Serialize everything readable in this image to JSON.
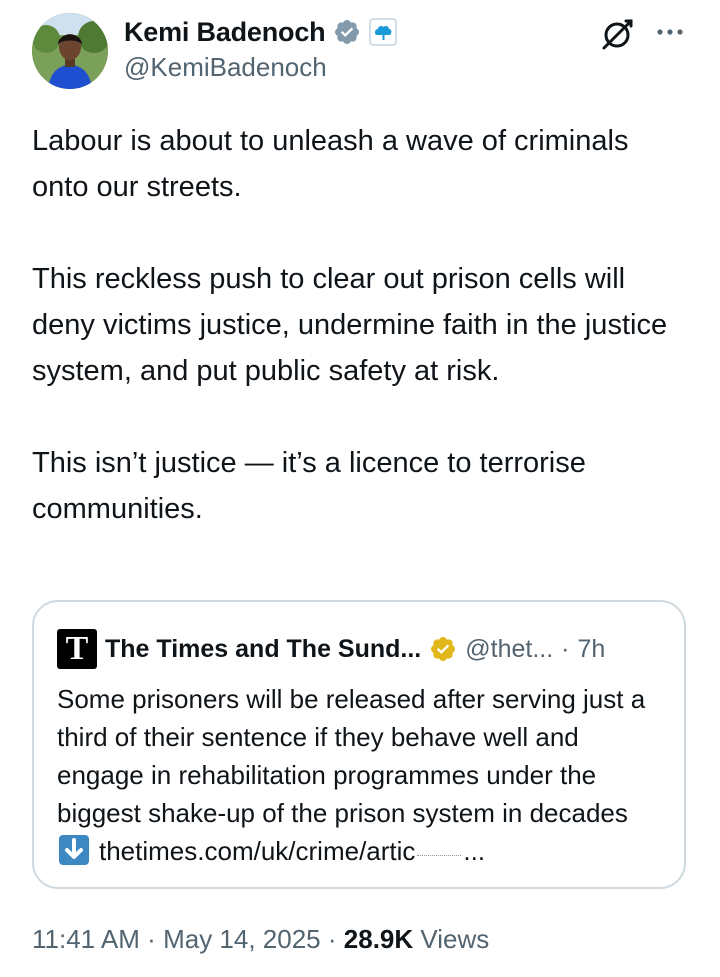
{
  "author": {
    "display_name": "Kemi Badenoch",
    "handle": "@KemiBadenoch",
    "verified_icon": "verified-badge-icon",
    "affiliation_icon": "conservative-tree-badge-icon"
  },
  "header_icons": {
    "grok": "grok-icon",
    "more": "more-options-icon"
  },
  "tweet": {
    "paragraphs": [
      "Labour is about to unleash a wave of criminals onto our streets.",
      "This reckless push to clear out prison cells will deny victims justice, undermine faith in the justice system, and put public safety at risk.",
      "This isn’t justice — it’s a licence to terrorise communities."
    ]
  },
  "quote": {
    "avatar_letter": "T",
    "name": "The Times and The Sund...",
    "handle": "@thet...",
    "separator": "·",
    "time": "7h",
    "text": "Some prisoners will be released after serving just a third of their sentence if they behave well and engage in rehabilitation programmes under the biggest shake-up of the prison system in decades",
    "link_icon": "down-arrow-emoji-icon",
    "link": "thetimes.com/uk/crime/artic",
    "ellipsis": "..."
  },
  "meta": {
    "time": "11:41 AM",
    "sep1": "·",
    "date": "May 14, 2025",
    "sep2": "·",
    "views_count": "28.9K",
    "views_label": "Views"
  },
  "colors": {
    "text": "#0f1419",
    "secondary": "#536471",
    "verified": "#829aab",
    "gold_badge": "#e2b719",
    "border": "#cfd9de",
    "affiliation_blue": "#1a9bd7"
  }
}
